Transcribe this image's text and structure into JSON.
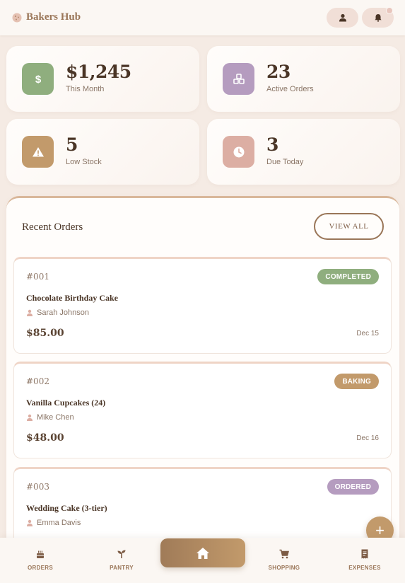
{
  "header": {
    "title": "Bakers Hub",
    "brand_icon": "cookie-icon",
    "profile_icon": "user-icon",
    "notifications_icon": "bell-icon"
  },
  "stats": [
    {
      "value": "$1,245",
      "label": "This Month",
      "icon": "dollar-icon",
      "color": "#8fae7e"
    },
    {
      "value": "23",
      "label": "Active Orders",
      "icon": "boxes-icon",
      "color": "#b59cbf"
    },
    {
      "value": "5",
      "label": "Low Stock",
      "icon": "warning-icon",
      "color": "#c29a6b"
    },
    {
      "value": "3",
      "label": "Due Today",
      "icon": "clock-icon",
      "color": "#dcaea3"
    }
  ],
  "orders_section": {
    "title": "Recent Orders",
    "view_all_label": "VIEW ALL",
    "orders": [
      {
        "id": "#001",
        "name": "Chocolate Birthday Cake",
        "customer": "Sarah Johnson",
        "price": "$85.00",
        "date": "Dec 15",
        "status": "COMPLETED",
        "status_color": "#8fae7e"
      },
      {
        "id": "#002",
        "name": "Vanilla Cupcakes (24)",
        "customer": "Mike Chen",
        "price": "$48.00",
        "date": "Dec 16",
        "status": "BAKING",
        "status_color": "#c29a6b"
      },
      {
        "id": "#003",
        "name": "Wedding Cake (3-tier)",
        "customer": "Emma Davis",
        "price": "",
        "date": "",
        "status": "ORDERED",
        "status_color": "#b59cbf"
      }
    ]
  },
  "fab": {
    "label": "+"
  },
  "bottom_nav": {
    "items": [
      {
        "label": "ORDERS",
        "icon": "cake-icon"
      },
      {
        "label": "PANTRY",
        "icon": "sprout-icon"
      },
      {
        "label": "",
        "icon": "home-icon"
      },
      {
        "label": "SHOPPING",
        "icon": "cart-icon"
      },
      {
        "label": "EXPENSES",
        "icon": "receipt-icon"
      }
    ]
  }
}
